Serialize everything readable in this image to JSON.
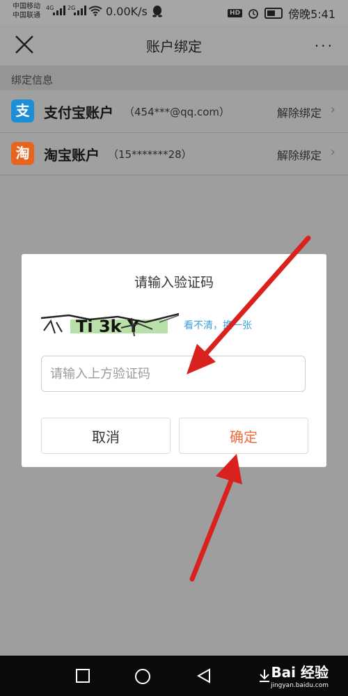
{
  "status_bar": {
    "carrier_1": "中国移动",
    "carrier_2": "中国联通",
    "signal_1_label": "4G",
    "signal_2_label": "2G",
    "net_speed": "0.00K/s",
    "hd_badge": "HD",
    "time": "傍晚5:41"
  },
  "header": {
    "title": "账户绑定",
    "more_label": "···"
  },
  "section": {
    "label": "绑定信息"
  },
  "accounts": [
    {
      "logo": "支",
      "name": "支付宝账户",
      "detail": "（454***@qq.com）",
      "action": "解除绑定",
      "color": "#1a8fd8"
    },
    {
      "logo": "淘",
      "name": "淘宝账户",
      "detail": "（15*******28）",
      "action": "解除绑定",
      "color": "#e8631c"
    }
  ],
  "dialog": {
    "title": "请输入验证码",
    "captcha_text": "Ti 3k Y",
    "refresh_label": "看不清，换一张",
    "input_placeholder": "请输入上方验证码",
    "cancel_label": "取消",
    "confirm_label": "确定"
  },
  "watermark": {
    "brand": "Bai 经验",
    "url": "jingyan.baidu.com"
  },
  "colors": {
    "accent_orange": "#f06a3c",
    "link_blue": "#3aa0d8",
    "arrow_red": "#d9211e"
  }
}
